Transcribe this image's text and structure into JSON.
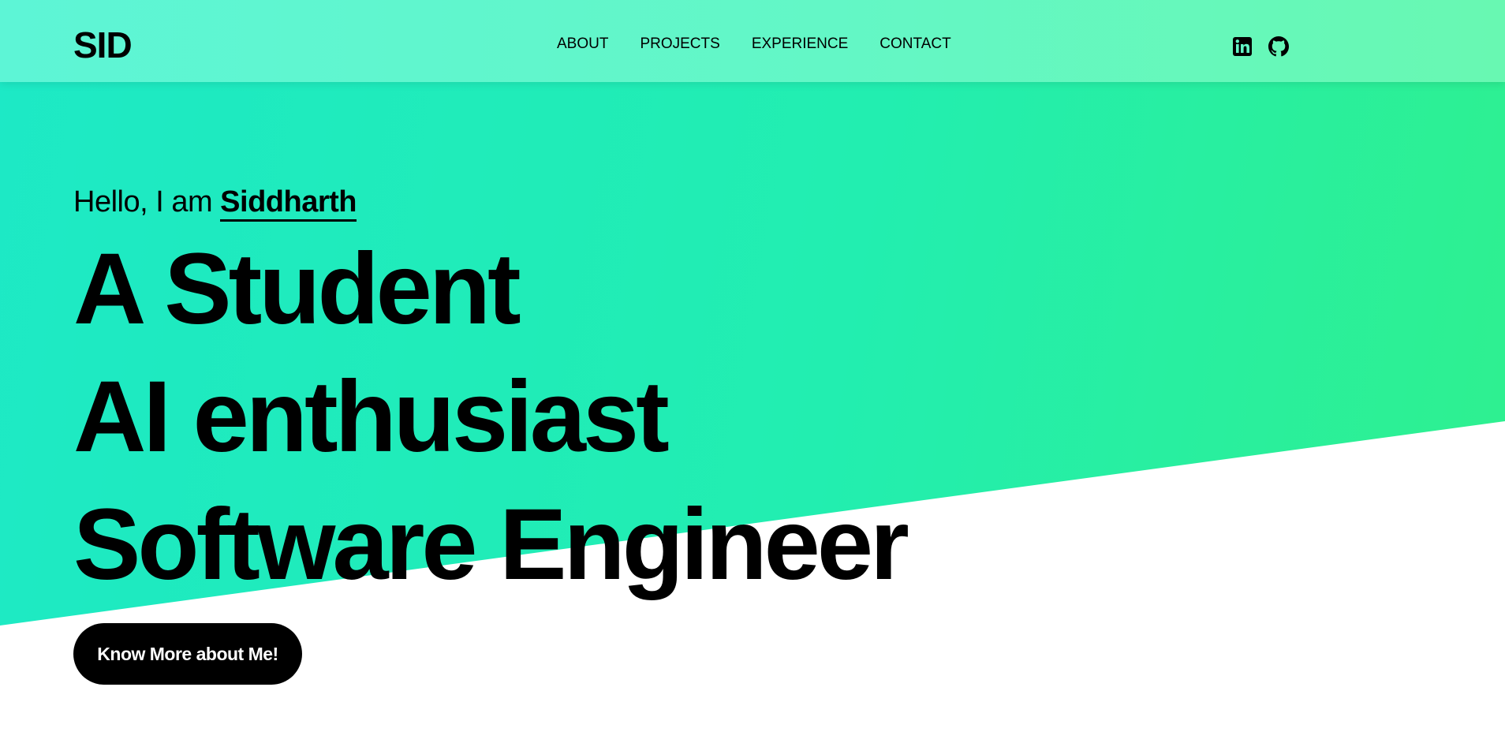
{
  "brand": {
    "logo": "SID"
  },
  "nav": {
    "links": [
      {
        "label": "ABOUT"
      },
      {
        "label": "PROJECTS"
      },
      {
        "label": "EXPERIENCE"
      },
      {
        "label": "CONTACT"
      }
    ],
    "social": [
      {
        "icon": "linkedin-icon"
      },
      {
        "icon": "github-icon"
      }
    ]
  },
  "hero": {
    "greeting_prefix": "Hello, I am ",
    "name": "Siddharth",
    "lines": [
      "A Student",
      "AI enthusiast",
      "Software Engineer"
    ],
    "cta_label": "Know More about Me!"
  },
  "colors": {
    "accent_start": "#1de9c6",
    "accent_end": "#2ff08e",
    "navbar": "#63f7c6",
    "text": "#000000",
    "button_bg": "#000000",
    "button_text": "#ffffff"
  }
}
